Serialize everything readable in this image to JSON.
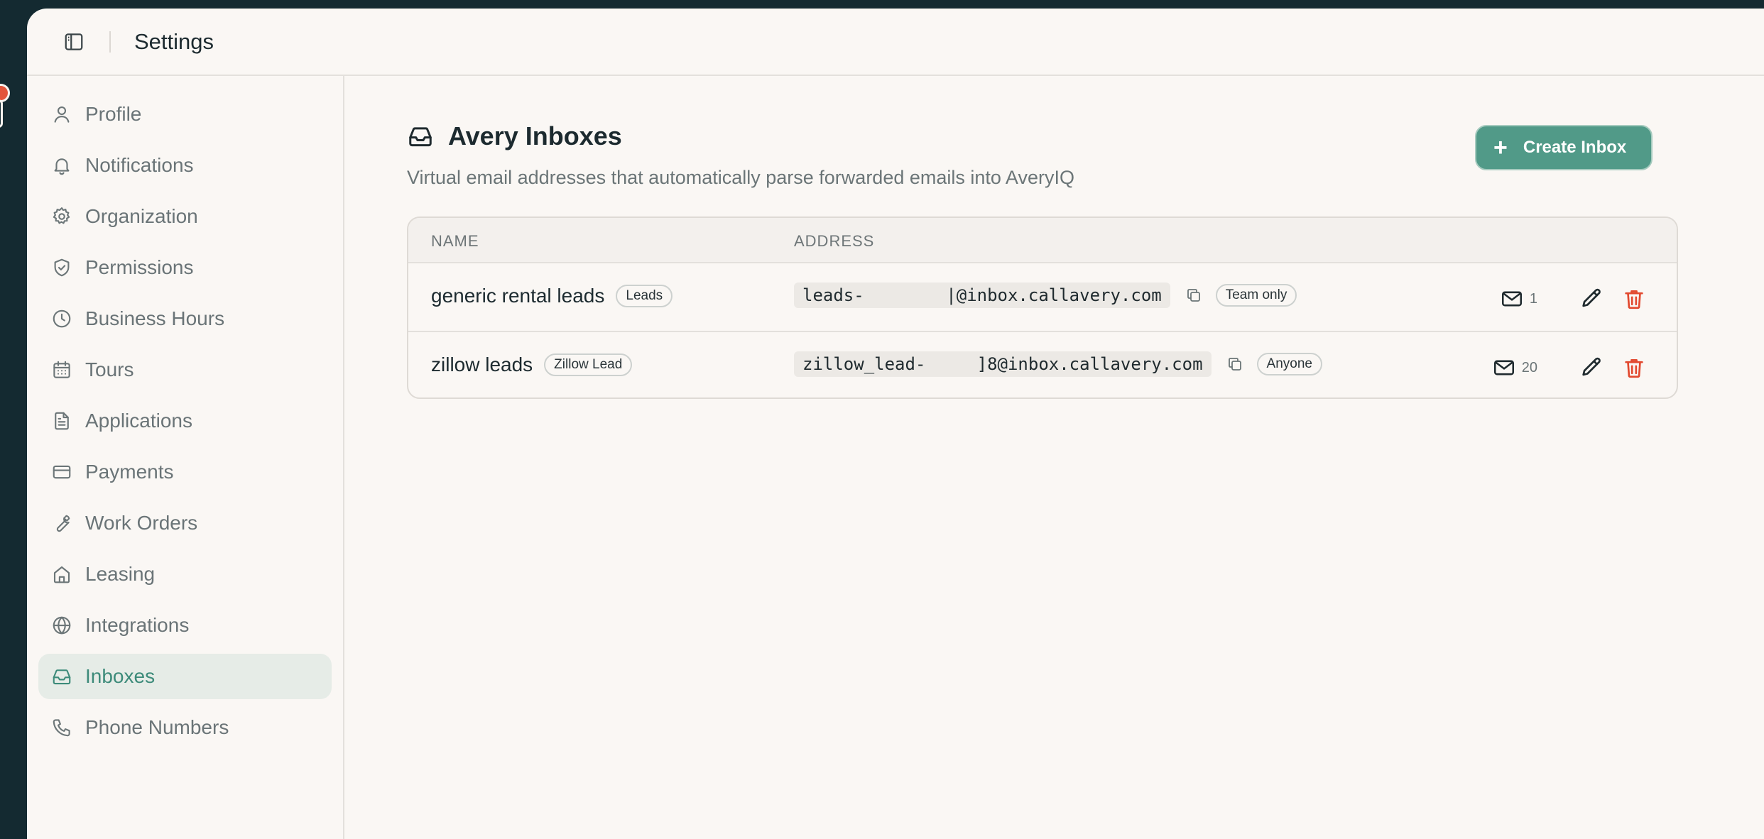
{
  "topbar": {
    "title": "Settings",
    "toggle_icon": "sidebar-toggle-icon"
  },
  "sidebar": {
    "items": [
      {
        "label": "Profile",
        "icon": "user-icon",
        "active": false
      },
      {
        "label": "Notifications",
        "icon": "bell-icon",
        "active": false
      },
      {
        "label": "Organization",
        "icon": "gear-icon",
        "active": false
      },
      {
        "label": "Permissions",
        "icon": "shield-check-icon",
        "active": false
      },
      {
        "label": "Business Hours",
        "icon": "clock-icon",
        "active": false
      },
      {
        "label": "Tours",
        "icon": "calendar-icon",
        "active": false
      },
      {
        "label": "Applications",
        "icon": "document-icon",
        "active": false
      },
      {
        "label": "Payments",
        "icon": "credit-card-icon",
        "active": false
      },
      {
        "label": "Work Orders",
        "icon": "wrench-icon",
        "active": false
      },
      {
        "label": "Leasing",
        "icon": "home-icon",
        "active": false
      },
      {
        "label": "Integrations",
        "icon": "globe-icon",
        "active": false
      },
      {
        "label": "Inboxes",
        "icon": "inbox-icon",
        "active": true
      },
      {
        "label": "Phone Numbers",
        "icon": "phone-icon",
        "active": false
      }
    ]
  },
  "main": {
    "title": "Avery Inboxes",
    "subtitle": "Virtual email addresses that automatically parse forwarded emails into AveryIQ",
    "create_button_label": "Create Inbox",
    "columns": {
      "name": "NAME",
      "address": "ADDRESS"
    },
    "rows": [
      {
        "name": "generic rental leads",
        "tag": "Leads",
        "address": "leads-        |@inbox.callavery.com",
        "visibility": "Team only",
        "email_count": "1"
      },
      {
        "name": "zillow leads",
        "tag": "Zillow Lead",
        "address": "zillow_lead-     ]8@inbox.callavery.com",
        "visibility": "Anyone",
        "email_count": "20"
      }
    ]
  },
  "colors": {
    "accent": "#519a88",
    "active_nav_bg": "#e6ece7",
    "active_nav_text": "#3d8b7a",
    "delete": "#e2492f",
    "background": "#faf7f4",
    "frame": "#142a31"
  }
}
